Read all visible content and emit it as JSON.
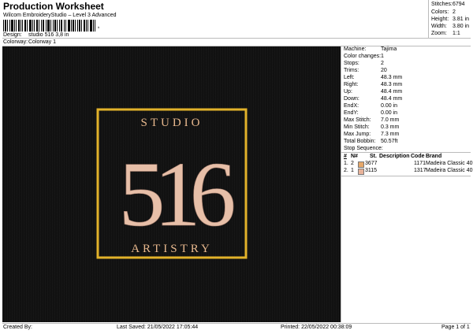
{
  "header": {
    "title": "Production Worksheet",
    "software": "Wilcom EmbroideryStudio – Level 3 Advanced",
    "barcode_suffix": ","
  },
  "design_info": [
    {
      "label": "Design:",
      "value": "studio 516 3,8 in"
    },
    {
      "label": "Colorway:",
      "value": "Colorway 1"
    }
  ],
  "summary": [
    {
      "label": "Stitches:",
      "value": "6794"
    },
    {
      "label": "Colors:",
      "value": "2"
    },
    {
      "label": "Height:",
      "value": "3.81 in"
    },
    {
      "label": "Width:",
      "value": "3.80 in"
    },
    {
      "label": "Zoom:",
      "value": "1:1"
    }
  ],
  "machine_info": [
    {
      "label": "Machine:",
      "value": "Tajima"
    },
    {
      "label": "Color changes:",
      "value": "1"
    },
    {
      "label": "Stops:",
      "value": "2"
    },
    {
      "label": "Trims:",
      "value": "20"
    },
    {
      "label": "Left:",
      "value": "48.3 mm"
    },
    {
      "label": "Right:",
      "value": "48.3 mm"
    },
    {
      "label": "Up:",
      "value": "48.4 mm"
    },
    {
      "label": "Down:",
      "value": "48.4 mm"
    },
    {
      "label": "EndX:",
      "value": "0.00 in"
    },
    {
      "label": "EndY:",
      "value": "0.00 in"
    },
    {
      "label": "Max Stitch:",
      "value": "7.0 mm"
    },
    {
      "label": "Min Stitch:",
      "value": "0.3 mm"
    },
    {
      "label": "Max Jump:",
      "value": "7.3 mm"
    },
    {
      "label": "Total Bobbin:",
      "value": "50.57ft"
    }
  ],
  "stop_sequence": {
    "title": "Stop Sequence:",
    "headers": [
      "#",
      "N#",
      "St.",
      "Description",
      "Code",
      "Brand"
    ],
    "rows": [
      {
        "idx": "1.",
        "n": "2",
        "color": "#e6a86b",
        "st": "3677",
        "desc": "",
        "code": "1171",
        "brand": "Madeira Classic 40"
      },
      {
        "idx": "2.",
        "n": "1",
        "color": "#e8b39a",
        "st": "3115",
        "desc": "",
        "code": "1317",
        "brand": "Madeira Classic 40"
      }
    ]
  },
  "artwork": {
    "top_text": "STUDIO",
    "numbers": "516",
    "bottom_text": "ARTISTRY",
    "frame_color": "#e2b22a",
    "letter_color": "#e9b98e",
    "number_color": "#e7bfa8"
  },
  "footer": {
    "created_by": "Created By:",
    "last_saved": "Last Saved: 21/05/2022 17:05:44",
    "printed": "Printed: 22/05/2022 00:38:09",
    "page": "Page 1 of 1"
  }
}
